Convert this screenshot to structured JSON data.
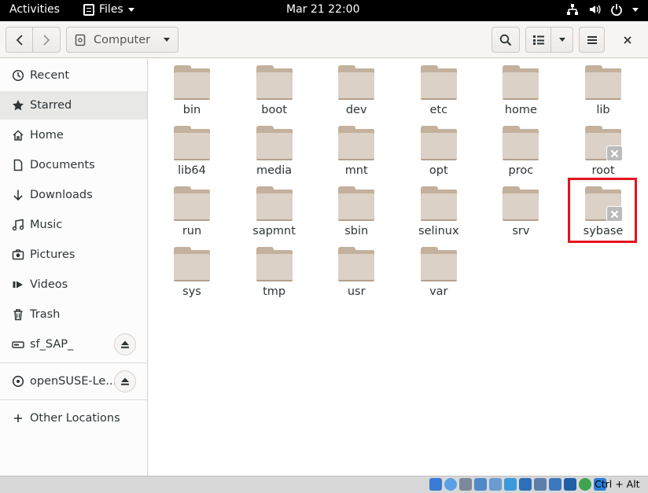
{
  "topbar": {
    "activities": "Activities",
    "app_name": "Files",
    "datetime": "Mar 21  22:00",
    "status_icons": [
      "network-icon",
      "volume-icon",
      "power-icon"
    ]
  },
  "headerbar": {
    "location": "Computer",
    "icons": [
      "go-back-icon",
      "go-forward-icon",
      "drive-icon",
      "search-icon",
      "list-view-icon",
      "chevron-down-icon",
      "hamburger-menu-icon",
      "close-icon"
    ]
  },
  "sidebar": {
    "items": [
      {
        "label": "Recent",
        "icon": "clock-icon"
      },
      {
        "label": "Starred",
        "icon": "star-icon"
      },
      {
        "label": "Home",
        "icon": "home-icon"
      },
      {
        "label": "Documents",
        "icon": "document-icon"
      },
      {
        "label": "Downloads",
        "icon": "download-icon"
      },
      {
        "label": "Music",
        "icon": "music-icon"
      },
      {
        "label": "Pictures",
        "icon": "camera-icon"
      },
      {
        "label": "Videos",
        "icon": "video-icon"
      },
      {
        "label": "Trash",
        "icon": "trash-icon"
      }
    ],
    "devices": [
      {
        "label": "sf_SAP_",
        "icon": "drive-icon"
      },
      {
        "label": "openSUSE-Le...",
        "icon": "optical-disc-icon"
      }
    ],
    "other": {
      "label": "Other Locations",
      "icon": "plus-icon"
    }
  },
  "folders": [
    {
      "name": "bin",
      "locked": false
    },
    {
      "name": "boot",
      "locked": false
    },
    {
      "name": "dev",
      "locked": false
    },
    {
      "name": "etc",
      "locked": false
    },
    {
      "name": "home",
      "locked": false
    },
    {
      "name": "lib",
      "locked": false
    },
    {
      "name": "lib64",
      "locked": false
    },
    {
      "name": "media",
      "locked": false
    },
    {
      "name": "mnt",
      "locked": false
    },
    {
      "name": "opt",
      "locked": false
    },
    {
      "name": "proc",
      "locked": false
    },
    {
      "name": "root",
      "locked": true
    },
    {
      "name": "run",
      "locked": false
    },
    {
      "name": "sapmnt",
      "locked": false
    },
    {
      "name": "sbin",
      "locked": false
    },
    {
      "name": "selinux",
      "locked": false
    },
    {
      "name": "srv",
      "locked": false
    },
    {
      "name": "sybase",
      "locked": true
    },
    {
      "name": "sys",
      "locked": false
    },
    {
      "name": "tmp",
      "locked": false
    },
    {
      "name": "usr",
      "locked": false
    },
    {
      "name": "var",
      "locked": false
    }
  ],
  "colors": {
    "folder_front": "#dcd1c6",
    "folder_back": "#c3b19d",
    "highlight": "#e3141d",
    "sidebar_active": "#e8e8e7"
  },
  "vmbar": {
    "host_key": "Ctrl + Alt"
  }
}
